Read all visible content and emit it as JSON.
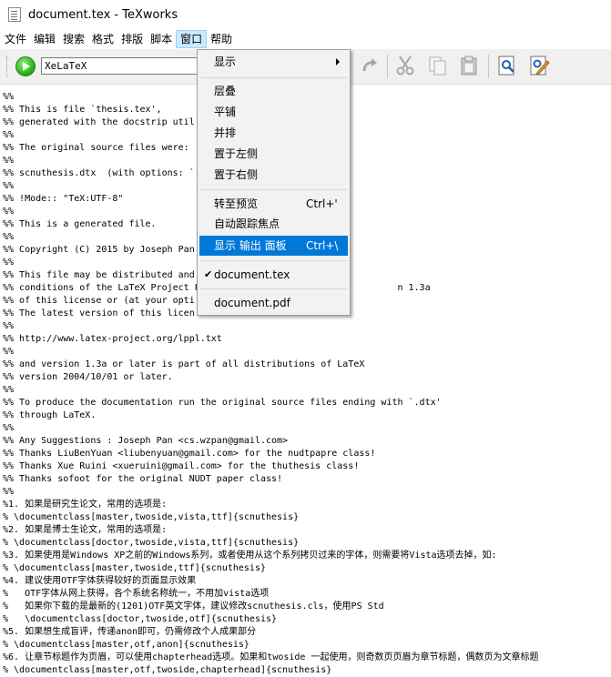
{
  "window": {
    "title": "document.tex - TeXworks"
  },
  "menubar": {
    "items": [
      "文件",
      "编辑",
      "搜索",
      "格式",
      "排版",
      "脚本",
      "窗口",
      "帮助"
    ],
    "active_index": 6
  },
  "toolbar": {
    "engine": "XeLaTeX",
    "icons": [
      "typeset-icon",
      "redo-icon",
      "cut-icon",
      "copy-icon",
      "paste-icon",
      "find-icon",
      "replace-icon"
    ]
  },
  "window_menu": {
    "items": [
      {
        "label": "显示",
        "shortcut": "",
        "submenu": true
      },
      {
        "label": "层叠",
        "shortcut": ""
      },
      {
        "label": "平铺",
        "shortcut": ""
      },
      {
        "label": "并排",
        "shortcut": ""
      },
      {
        "label": "置于左侧",
        "shortcut": ""
      },
      {
        "label": "置于右侧",
        "shortcut": ""
      },
      {
        "label": "转至预览",
        "shortcut": "Ctrl+'"
      },
      {
        "label": "自动跟踪焦点",
        "shortcut": ""
      },
      {
        "label": "显示 输出 面板",
        "shortcut": "Ctrl+\\",
        "highlighted": true
      },
      {
        "label": "document.tex",
        "shortcut": "",
        "checked": true
      },
      {
        "label": "document.pdf",
        "shortcut": ""
      }
    ]
  },
  "editor": {
    "lines": [
      "%%",
      "%% This is file `thesis.tex',",
      "%% generated with the docstrip util",
      "%%",
      "%% The original source files were:",
      "%%",
      "%% scnuthesis.dtx  (with options: `",
      "%%",
      "%% !Mode:: \"TeX:UTF-8\"",
      "%%",
      "%% This is a generated file.",
      "%%",
      "%% Copyright (C) 2015 by Joseph Pan",
      "%%",
      "%% This file may be distributed and",
      "%% conditions of the LaTeX Project P                                    n 1.3a",
      "%% of this license or (at your opti",
      "%% The latest version of this licen",
      "%%",
      "%% http://www.latex-project.org/lppl.txt",
      "%%",
      "%% and version 1.3a or later is part of all distributions of LaTeX",
      "%% version 2004/10/01 or later.",
      "%%",
      "%% To produce the documentation run the original source files ending with `.dtx'",
      "%% through LaTeX.",
      "%%",
      "%% Any Suggestions : Joseph Pan <cs.wzpan@gmail.com>",
      "%% Thanks LiuBenYuan <liubenyuan@gmail.com> for the nudtpapre class!",
      "%% Thanks Xue Ruini <xueruini@gmail.com> for the thuthesis class!",
      "%% Thanks sofoot for the original NUDT paper class!",
      "%%",
      "%1. 如果是研究生论文，常用的选项是:",
      "% \\documentclass[master,twoside,vista,ttf]{scnuthesis}",
      "%2. 如果是博士生论文，常用的选项是:",
      "% \\documentclass[doctor,twoside,vista,ttf]{scnuthesis}",
      "%3. 如果使用是Windows XP之前的Windows系列，或者使用从这个系列拷贝过来的字体，则需要将Vista选项去掉，如:",
      "% \\documentclass[master,twoside,ttf]{scnuthesis}",
      "%4. 建议使用OTF字体获得较好的页面显示效果",
      "%   OTF字体从网上获得，各个系统名称统一，不用加vista选项",
      "%   如果你下载的是最新的(1201)OTF英文字体，建议修改scnuthesis.cls，使用PS Std",
      "%   \\documentclass[doctor,twoside,otf]{scnuthesis}",
      "%5. 如果想生成盲评，传递anon即可，仍需修改个人成果部分",
      "% \\documentclass[master,otf,anon]{scnuthesis}",
      "%6. 让章节标题作为页眉，可以使用chapterhead选项。如果和twoside 一起使用，则奇数页页眉为章节标题，偶数页为文章标题",
      "% \\documentclass[master,otf,twoside,chapterhead]{scnuthesis}"
    ]
  }
}
